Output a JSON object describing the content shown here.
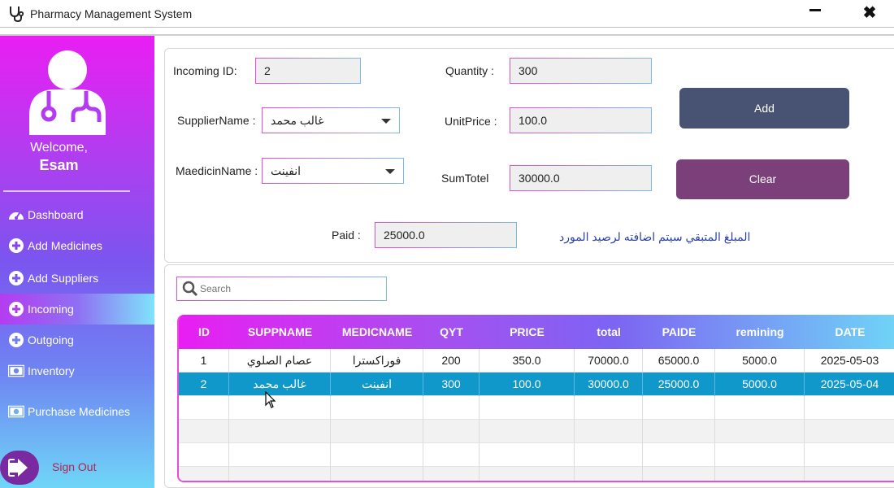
{
  "window": {
    "title": "Pharmacy Management System",
    "minimize": "",
    "close": "✖"
  },
  "sidebar": {
    "welcome": "Welcome,",
    "username": "Esam",
    "items": [
      {
        "label": "Dashboard",
        "icon": "dashboard-icon"
      },
      {
        "label": "Add Medicines",
        "icon": "plus-circle-icon"
      },
      {
        "label": "Add Suppliers",
        "icon": "plus-circle-icon"
      },
      {
        "label": "Incoming",
        "icon": "plus-circle-icon",
        "active": true
      },
      {
        "label": "Outgoing",
        "icon": "plus-circle-icon"
      },
      {
        "label": "Inventory",
        "icon": "money-icon"
      },
      {
        "label": "Purchase Medicines",
        "icon": "money-icon"
      }
    ],
    "signout": "Sign Out"
  },
  "form": {
    "incoming_id_label": "Incoming ID:",
    "incoming_id": "2",
    "supplier_label": "SupplierName :",
    "supplier": "غالب محمد",
    "medicine_label": "MaedicinName :",
    "medicine": "انفينت",
    "quantity_label": "Quantity :",
    "quantity": "300",
    "unitprice_label": "UnitPrice :",
    "unitprice": "100.0",
    "sumtotal_label": "SumTotel",
    "sumtotal": "30000.0",
    "paid_label": "Paid :",
    "paid": "25000.0",
    "add_label": "Add",
    "clear_label": "Clear",
    "note": "المبلغ المتبقي سيتم اضافته لرصيد المورد"
  },
  "search": {
    "placeholder": "Search"
  },
  "table": {
    "columns": [
      "ID",
      "SUPPNAME",
      "MEDICNAME",
      "QYT",
      "PRICE",
      "total",
      "PAIDE",
      "remining",
      "DATE"
    ],
    "rows": [
      [
        "1",
        "عصام الصلوي",
        "فوراكسترا",
        "200",
        "350.0",
        "70000.0",
        "65000.0",
        "5000.0",
        "2025-05-03"
      ],
      [
        "2",
        "غالب محمد",
        "انفينت",
        "300",
        "100.0",
        "30000.0",
        "25000.0",
        "5000.0",
        "2025-05-04"
      ]
    ],
    "selected_row": 1
  },
  "colors": {
    "add_button": "#485273",
    "clear_button": "#7b3f7a",
    "selected_row": "#0f98c9",
    "note_text": "#2b3fa8"
  }
}
